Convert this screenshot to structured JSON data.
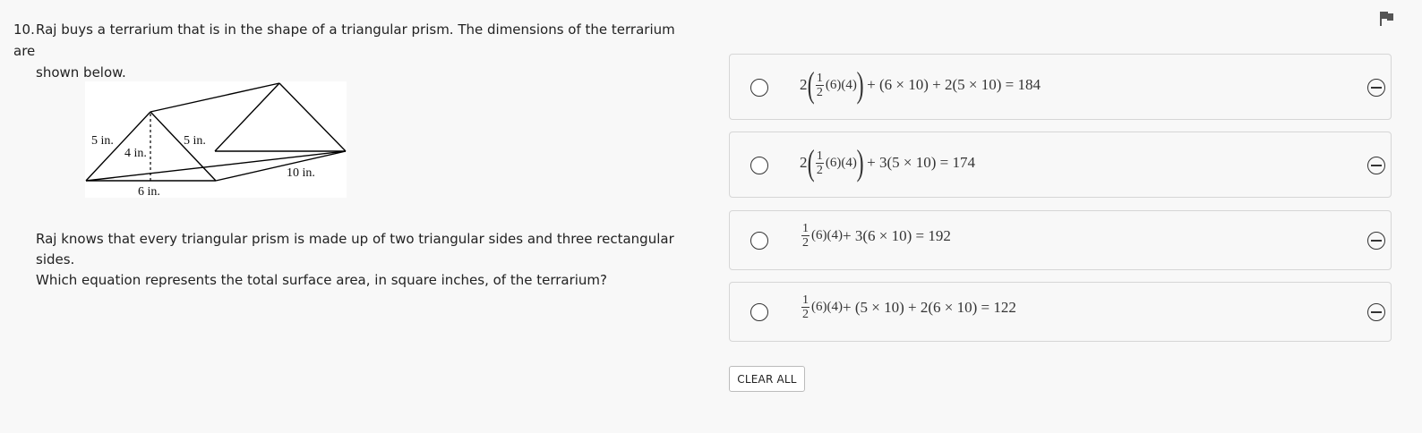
{
  "question": {
    "number": "10.",
    "text_line1": "Raj buys a terrarium that is in the shape of a triangular prism. The dimensions of the terrarium are",
    "text_line2": "shown below.",
    "stem_line1": "Raj knows that every triangular prism is made up of two triangular sides and three rectangular sides.",
    "stem_line2": "Which equation represents the total surface area, in square inches, of the terrarium?"
  },
  "figure": {
    "labels": {
      "side_left": "5 in.",
      "height": "4 in.",
      "side_right": "5 in.",
      "base": "6 in.",
      "length": "10 in."
    }
  },
  "choices": [
    {
      "lead": "2",
      "frac_num": "1",
      "frac_den": "2",
      "inner": "(6)(4)",
      "rest": "+ (6 × 10) + 2(5 × 10) = 184",
      "parens": true
    },
    {
      "lead": "2",
      "frac_num": "1",
      "frac_den": "2",
      "inner": "(6)(4)",
      "rest": "+ 3(5 × 10) = 174",
      "parens": true
    },
    {
      "lead": "",
      "frac_num": "1",
      "frac_den": "2",
      "inner": "(6)(4)",
      "rest": "+ 3(6 × 10) = 192",
      "parens": false
    },
    {
      "lead": "",
      "frac_num": "1",
      "frac_den": "2",
      "inner": "(6)(4)",
      "rest": "+ (5 × 10) + 2(6 × 10) = 122",
      "parens": false
    }
  ],
  "clear_all_label": "CLEAR ALL",
  "icons": {
    "flag": "flag-icon",
    "radio": "radio-button-icon",
    "strike": "eliminate-choice-icon"
  }
}
